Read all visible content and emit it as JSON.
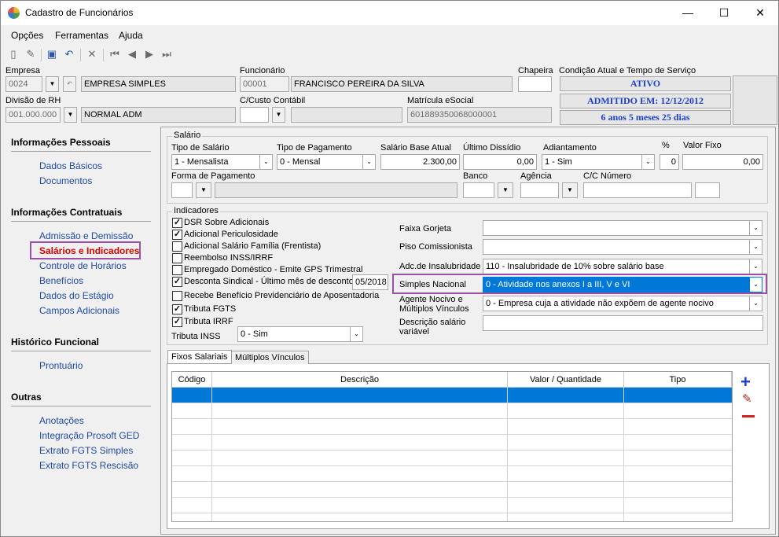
{
  "window": {
    "title": "Cadastro de Funcionários"
  },
  "menu": {
    "opcoes": "Opções",
    "ferramentas": "Ferramentas",
    "ajuda": "Ajuda"
  },
  "header": {
    "empresa_label": "Empresa",
    "empresa_code": "0024",
    "empresa_name": "EMPRESA SIMPLES",
    "funcionario_label": "Funcionário",
    "funcionario_code": "00001",
    "funcionario_name": "FRANCISCO PEREIRA DA SILVA",
    "chapeira_label": "Chapeira",
    "chapeira_value": "",
    "condicao_label": "Condição Atual e Tempo de Serviço",
    "status": "ATIVO",
    "admitido": "ADMITIDO EM: 12/12/2012",
    "tempo": "6 anos 5 meses 25 dias",
    "divisao_label": "Divisão de RH",
    "divisao_code": "001.000.000",
    "divisao_name": "NORMAL ADM",
    "custo_label": "C/Custo Contábil",
    "matricula_label": "Matrícula eSocial",
    "matricula_value": "601889350068000001"
  },
  "sidebar": {
    "sec1": "Informações Pessoais",
    "dados_basicos": "Dados Básicos",
    "documentos": "Documentos",
    "sec2": "Informações Contratuais",
    "admissao": "Admissão e Demissão",
    "salarios": "Salários e Indicadores",
    "controle": "Controle de Horários",
    "beneficios": "Benefícios",
    "estagio": "Dados do Estágio",
    "campos": "Campos Adicionais",
    "sec3": "Histórico Funcional",
    "prontuario": "Prontuário",
    "sec4": "Outras",
    "anotacoes": "Anotações",
    "integracao": "Integração Prosoft GED",
    "extrato_simples": "Extrato FGTS Simples",
    "extrato_rescisao": "Extrato FGTS Rescisão"
  },
  "salario": {
    "group": "Salário",
    "tipo_label": "Tipo de Salário",
    "tipo_value": "1 - Mensalista",
    "pagamento_label": "Tipo de Pagamento",
    "pagamento_value": "0 - Mensal",
    "base_label": "Salário Base Atual",
    "base_value": "2.300,00",
    "dissidio_label": "Último Dissídio",
    "dissidio_value": "0,00",
    "adiantamento_label": "Adiantamento",
    "adiantamento_value": "1 - Sim",
    "pct_label": "%",
    "pct_value": "0",
    "fixo_label": "Valor Fixo",
    "fixo_value": "0,00",
    "forma_label": "Forma de Pagamento",
    "banco_label": "Banco",
    "agencia_label": "Agência",
    "cc_label": "C/C Número"
  },
  "indicadores": {
    "group": "Indicadores",
    "checks": [
      {
        "label": "DSR Sobre Adicionais",
        "checked": true
      },
      {
        "label": "Adicional Periculosidade",
        "checked": true
      },
      {
        "label": "Adicional Salário Família (Frentista)",
        "checked": false
      },
      {
        "label": "Reembolso INSS/IRRF",
        "checked": false
      },
      {
        "label": "Empregado Doméstico - Emite GPS Trimestral",
        "checked": false
      },
      {
        "label": "Desconta Sindical - Último mês de desconto",
        "checked": true
      },
      {
        "label": "Recebe Benefício Previdenciário de Aposentadoria",
        "checked": false
      },
      {
        "label": "Tributa FGTS",
        "checked": true
      },
      {
        "label": "Tributa IRRF",
        "checked": true
      }
    ],
    "sindical_mes": "05/2018",
    "inss_label": "Tributa INSS",
    "inss_value": "0 - Sim",
    "faixa_label": "Faixa Gorjeta",
    "piso_label": "Piso Comissionista",
    "insalub_label": "Adc.de Insalubridade",
    "insalub_value": "110 - Insalubridade de 10% sobre salário base",
    "simples_label": "Simples Nacional",
    "simples_value": "0 - Atividade nos anexos I a III, V e VI",
    "nocivo_label1": "Agente Nocivo e",
    "nocivo_label2": "Múltiplos Vínculos",
    "nocivo_value": "0 - Empresa cuja a atividade não expõem de agente nocivo",
    "desc_label1": "Descrição salário",
    "desc_label2": "variável"
  },
  "tabs": {
    "fixos": "Fixos Salariais",
    "multiplos": "Múltiplos Vínculos"
  },
  "grid": {
    "codigo": "Código",
    "descricao": "Descrição",
    "valor": "Valor / Quantidade",
    "tipo": "Tipo"
  },
  "colors": {
    "accent": "#0078d7",
    "link": "#1f4aa8",
    "active_link": "#e00000",
    "status_text": "#1c3fcf",
    "highlight": "#9b4fa8"
  }
}
